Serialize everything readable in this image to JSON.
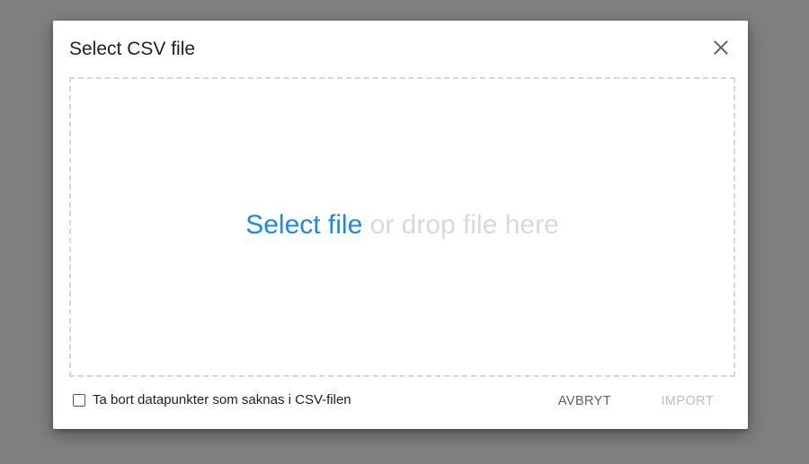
{
  "dialog": {
    "title": "Select CSV file",
    "close_icon": "close-icon"
  },
  "dropzone": {
    "select_link": "Select file",
    "hint": "or drop file here"
  },
  "options": {
    "remove_missing_label": "Ta bort datapunkter som saknas i CSV-filen",
    "remove_missing_checked": false
  },
  "actions": {
    "cancel_label": "AVBRYT",
    "import_label": "IMPORT",
    "import_enabled": false
  },
  "colors": {
    "backdrop": "#808080",
    "accent": "#1e88e5",
    "hint": "#d9d9d9",
    "disabled": "#bdbdbd"
  }
}
